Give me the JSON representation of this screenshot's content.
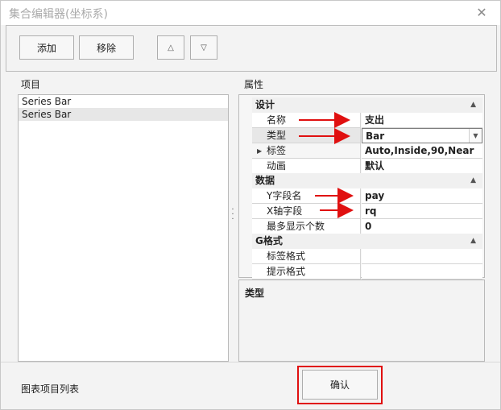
{
  "window": {
    "title": "集合编辑器(坐标系)",
    "close_glyph": "✕"
  },
  "toolbar": {
    "add_label": "添加",
    "remove_label": "移除",
    "up_glyph": "△",
    "down_glyph": "▽"
  },
  "items_panel": {
    "label": "项目",
    "items": [
      "Series Bar",
      "Series Bar"
    ]
  },
  "properties_panel": {
    "label": "属性",
    "categories": [
      {
        "name": "设计",
        "rows": [
          {
            "name": "名称",
            "value": "支出"
          },
          {
            "name": "类型",
            "value": "Bar"
          },
          {
            "name": "标签",
            "value": "Auto,Inside,90,Near"
          },
          {
            "name": "动画",
            "value": "默认"
          }
        ]
      },
      {
        "name": "数据",
        "rows": [
          {
            "name": "Y字段名",
            "value": "pay"
          },
          {
            "name": "X轴字段",
            "value": "rq"
          },
          {
            "name": "最多显示个数",
            "value": "0"
          }
        ]
      },
      {
        "name": "G格式",
        "rows": [
          {
            "name": "标签格式",
            "value": ""
          },
          {
            "name": "提示格式",
            "value": ""
          }
        ]
      }
    ],
    "description_title": "类型"
  },
  "footer": {
    "status_text": "图表项目列表",
    "ok_label": "确认"
  },
  "colors": {
    "annotation": "#e01010"
  }
}
